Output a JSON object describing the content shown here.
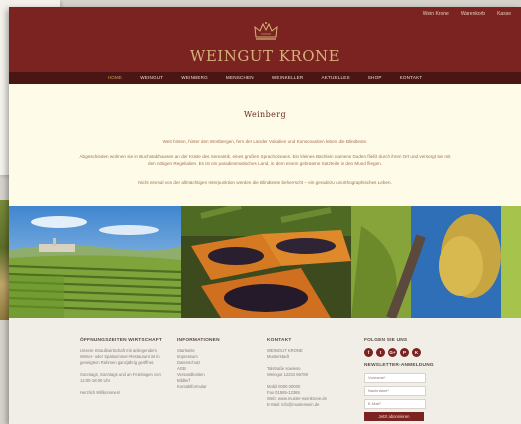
{
  "topbar": {
    "links": [
      "Wein Krone",
      "Warenkorb",
      "Kasse"
    ]
  },
  "brand": {
    "name": "WEINGUT KRONE"
  },
  "nav": {
    "items": [
      "HOME",
      "WEINGUT",
      "WEINBERG",
      "MENSCHEN",
      "WEINKELLER",
      "AKTUELLES",
      "SHOP",
      "KONTAKT"
    ],
    "active_index": 0
  },
  "content": {
    "title": "Weinberg",
    "paragraphs": [
      "Weit hinten, hinter den Wortbergen, fern der Länder Vokalien und Konsonantien leben die Blindtexte.",
      "Abgeschieden wohnen sie in Buchstabhausen an der Küste des Semantik, eines großen Sprachozeans. Ein kleines Bächlein namens Duden fließt durch ihren Ort und versorgt sie mit den nötigen Regelialien. Es ist ein paradiesmatisches Land, in dem einem gebratene Satzteile in den Mund fliegen.",
      "Nicht einmal von der allmächtigen Interpunktion werden die Blindtexte beherrscht – ein geradezu unorthographisches Leben."
    ]
  },
  "footer": {
    "col1": {
      "heading": "ÖFFNUNGSZEITEN WIRTSCHAFT",
      "lines": [
        "Unsere Straußwirtschaft mit anliegendem Winter- oder Spätsommer-Restaurant ist in geneigtem Rahmen ganzjährig geöffnet.",
        "",
        "Sonntags, Sonntags und an Feiertagen von 14:00-18:00 Uhr",
        "",
        "Herzlich Willkommen!"
      ]
    },
    "col2": {
      "heading": "INFORMATIONEN",
      "lines": [
        "Startseite",
        "Impressum",
        "Datenschutz",
        "AGB",
        "Versandkosten",
        "Bildlerf",
        "Kontaktformular"
      ]
    },
    "col3": {
      "heading": "KONTAKT",
      "lines": [
        "WEINGUT KRONE",
        "Musterstadt",
        "",
        "Talstraße sowieso",
        "Weingut 12234 66789",
        "",
        "Mobil 0000 00000",
        "Fax 01565-12365",
        "Web: www.muster-weinkrone.de",
        "E-Mail: info@musterwein.de"
      ]
    },
    "col4": {
      "heading": "FOLGEN SIE UNS",
      "social": [
        "f",
        "t",
        "G+",
        "P",
        "K"
      ],
      "newsletter_heading": "NEWSLETTER-ANMELDUNG",
      "fields": [
        "Vorname*",
        "Nachname*",
        "E-Mail*"
      ],
      "button": "Jetzt abonnieren"
    }
  },
  "colors": {
    "brand": "#7a2320",
    "nav": "#4a1614",
    "gold": "#d7b07a",
    "cream": "#fefbe8"
  }
}
